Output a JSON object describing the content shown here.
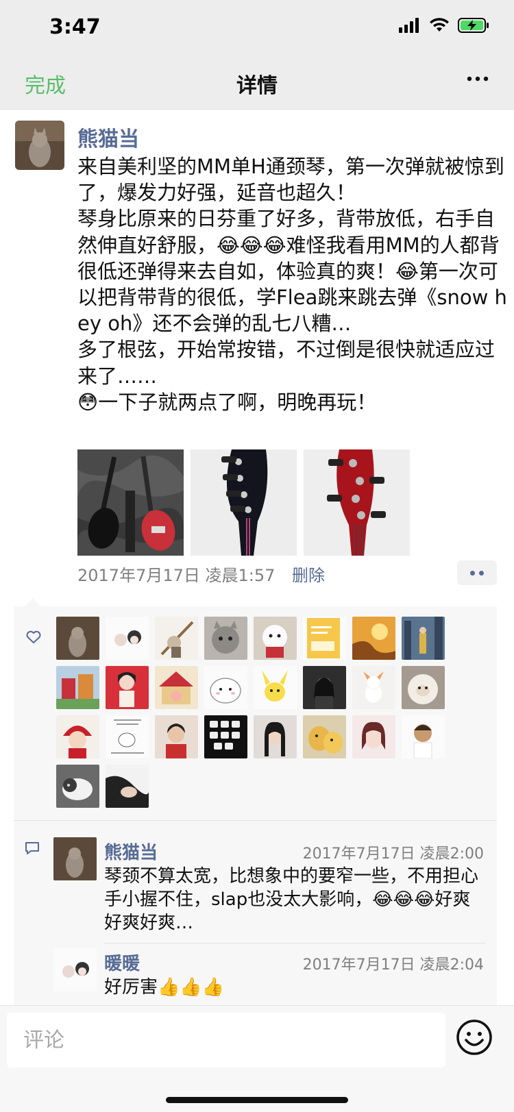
{
  "status_bar": {
    "time": "3:47"
  },
  "nav": {
    "done_label": "完成",
    "title": "详情",
    "more_label": "···"
  },
  "post": {
    "author": "熊猫当",
    "body": "来自美利坚的MM单H通颈琴，第一次弹就被惊到了，爆发力好强，延音也超久！\n琴身比原来的日芬重了好多，背带放低，右手自然伸直好舒服，😂😂😂难怪我看用MM的人都背很低还弹得来去自如，体验真的爽！😂第一次可以把背带背的很低，学Flea跳来跳去弹《snow hey oh》还不会弹的乱七八糟…\n多了根弦，开始常按错，不过倒是很快就适应过来了……\n😳一下子就两点了啊，明晚再玩！",
    "images": [
      "guitars-on-bed-photo",
      "black-headstock-photo",
      "red-headstock-photo"
    ],
    "timestamp": "2017年7月17日 凌晨1:57",
    "delete_label": "删除"
  },
  "likes": {
    "icon": "heart-outline-icon",
    "avatars": [
      "cat-avatar",
      "sketch-girl-avatar",
      "guitar-drawing-avatar",
      "gray-cat-avatar",
      "white-dog-avatar",
      "yellow-poster-avatar",
      "sunset-avatar",
      "city-avatar",
      "playground-avatar",
      "red-cartoon-avatar",
      "house-cartoon-avatar",
      "white-cat-cartoon-avatar",
      "pikachu-avatar",
      "woman-avatar",
      "figurine-avatar",
      "sheep-plush-avatar",
      "red-doll-avatar",
      "text-sticker-avatar",
      "woman-photo-avatar",
      "keyboard-avatar",
      "girl-photo-avatar",
      "dog-cartoon-avatar",
      "anime-girl-avatar",
      "3d-boy-avatar",
      "sleeping-cat-avatar",
      "lying-person-avatar"
    ]
  },
  "comments": [
    {
      "name": "熊猫当",
      "time": "2017年7月17日 凌晨2:00",
      "text": "琴颈不算太宽，比想象中的要窄一些，不用担心手小握不住，slap也没太大影响，😂😂😂好爽好爽好爽…"
    },
    {
      "name": "暖暖",
      "time": "2017年7月17日 凌晨2:04",
      "text": "好厉害👍👍👍"
    }
  ],
  "input": {
    "placeholder": "评论"
  },
  "colors": {
    "accent_green": "#57be6a",
    "link_blue": "#576b95",
    "meta_gray": "#7f7f7f",
    "panel_bg": "#f7f7f7"
  }
}
